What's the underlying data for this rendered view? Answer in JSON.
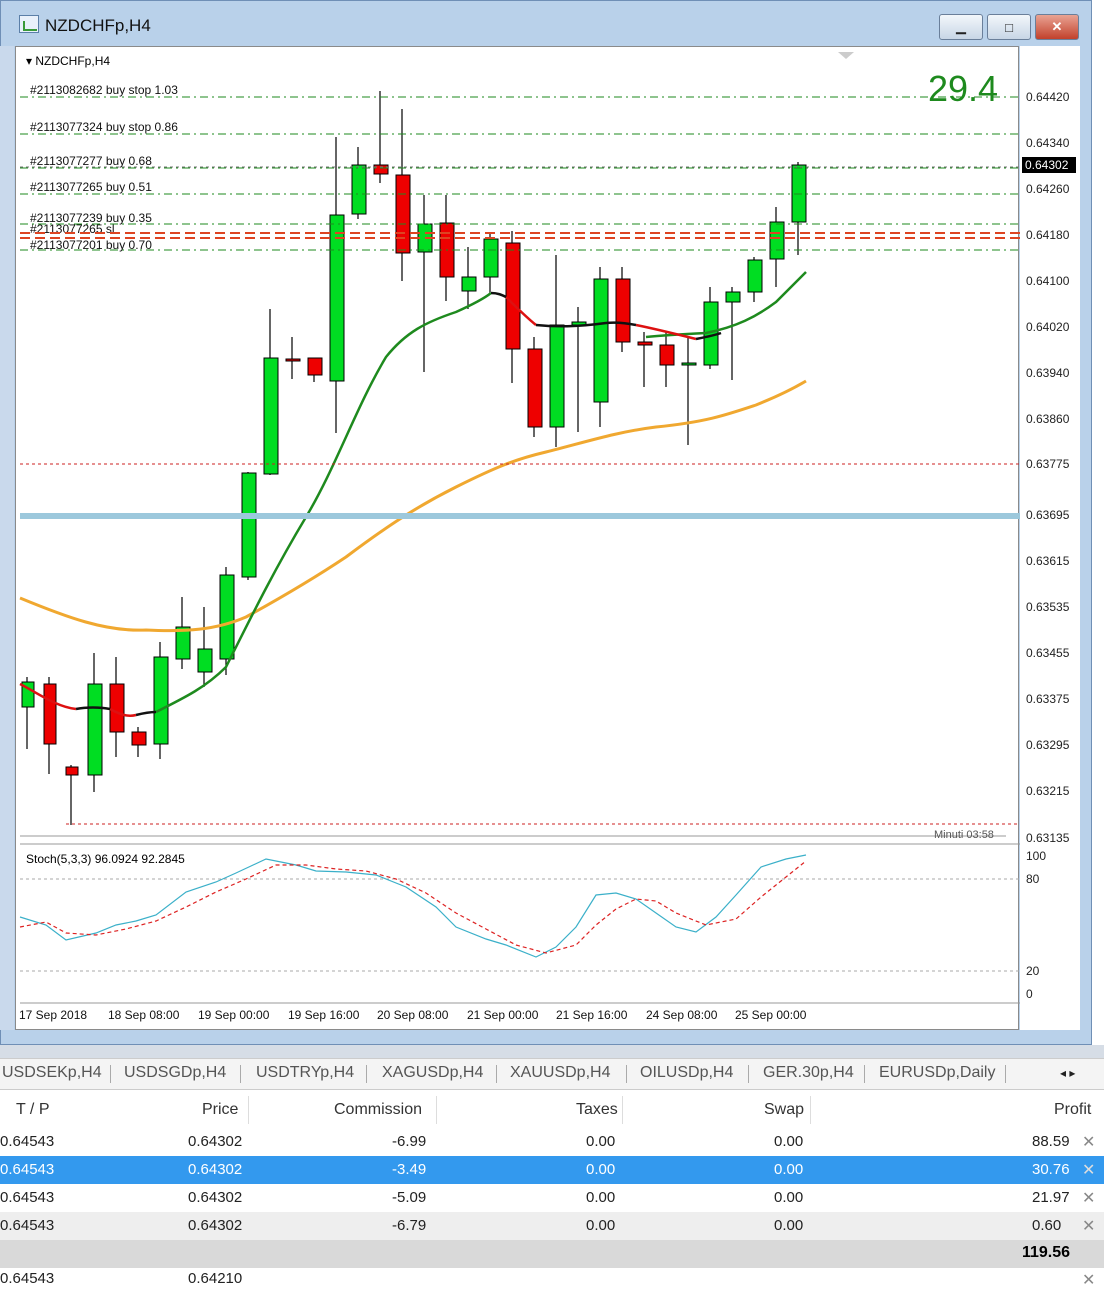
{
  "window": {
    "title": "NZDCHFp,H4",
    "btn_min": "▁",
    "btn_max": "□",
    "btn_close": "✕"
  },
  "chart": {
    "symbol_label": "▾ NZDCHFp,H4",
    "big_number": "29.4",
    "timer": "Minuti 03:58",
    "orders": [
      "#2113082682 buy stop 1.03",
      "#2113077324 buy stop 0.86",
      "#2113077277 buy 0.68",
      "#2113077265 buy 0.51",
      "#2113077239 buy 0.35",
      "#2113077201 buy 0.70"
    ],
    "overlap_text": "#2113077265 sl",
    "current_price": "0.64302",
    "price_levels": [
      "0.64420",
      "0.64340",
      "0.64260",
      "0.64180",
      "0.64100",
      "0.64020",
      "0.63940",
      "0.63860",
      "0.63775",
      "0.63695",
      "0.63615",
      "0.63535",
      "0.63455",
      "0.63375",
      "0.63295",
      "0.63215",
      "0.63135"
    ],
    "stoch_label": "Stoch(5,3,3) 96.0924 92.2845",
    "stoch_levels": [
      "100",
      "80",
      "20",
      "0"
    ],
    "time_labels": [
      "17 Sep 2018",
      "18 Sep 08:00",
      "19 Sep 00:00",
      "19 Sep 16:00",
      "20 Sep 08:00",
      "21 Sep 00:00",
      "21 Sep 16:00",
      "24 Sep 08:00",
      "25 Sep 00:00"
    ],
    "colors": {
      "bull": "#00dd22",
      "bear": "#ee0000",
      "ma_fast": "#1e8a1e",
      "ma_slow": "#f0a830",
      "stoch_main": "#3bb0c9",
      "stoch_signal": "#dd2222",
      "hline": "#9cc8dc"
    }
  },
  "tabs": [
    "USDSEKp,H4",
    "USDSGDp,H4",
    "USDTRYp,H4",
    "XAGUSDp,H4",
    "XAUUSDp,H4",
    "OILUSDp,H4",
    "GER.30p,H4",
    "EURUSDp,Daily"
  ],
  "tabs_arrows": "◂ ▸",
  "table": {
    "headers": {
      "tp": "T / P",
      "price": "Price",
      "commission": "Commission",
      "taxes": "Taxes",
      "swap": "Swap",
      "profit": "Profit"
    },
    "rows": [
      {
        "tp": "0.64543",
        "price": "0.64302",
        "commission": "-6.99",
        "taxes": "0.00",
        "swap": "0.00",
        "profit": "88.59"
      },
      {
        "tp": "0.64543",
        "price": "0.64302",
        "commission": "-3.49",
        "taxes": "0.00",
        "swap": "0.00",
        "profit": "30.76"
      },
      {
        "tp": "0.64543",
        "price": "0.64302",
        "commission": "-5.09",
        "taxes": "0.00",
        "swap": "0.00",
        "profit": "21.97"
      },
      {
        "tp": "0.64543",
        "price": "0.64302",
        "commission": "-6.79",
        "taxes": "0.00",
        "swap": "0.00",
        "profit": "0.60"
      }
    ],
    "total_profit": "119.56",
    "partial_row": {
      "tp": "0.64543",
      "price": "0.64210"
    },
    "close_icon": "✕"
  }
}
